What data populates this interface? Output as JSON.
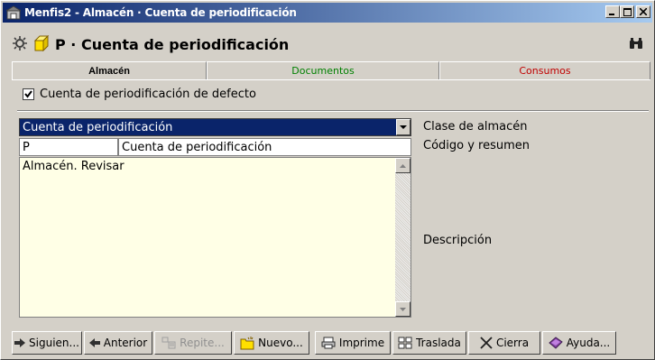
{
  "window": {
    "title": "Menfis2 - Almacén · Cuenta de periodificación"
  },
  "header": {
    "title": "P · Cuenta de periodificación"
  },
  "tabs": [
    {
      "label": "Almacén",
      "active": true,
      "color": "#000000"
    },
    {
      "label": "Documentos",
      "active": false,
      "color": "#008000"
    },
    {
      "label": "Consumos",
      "active": false,
      "color": "#c00000"
    }
  ],
  "form": {
    "default_checkbox_label": "Cuenta de periodificación de defecto",
    "default_checked": true,
    "clase_value": "Cuenta de periodificación",
    "codigo_value": "P",
    "resumen_value": "Cuenta de periodificación",
    "descripcion_value": "Almacén. Revisar",
    "labels": {
      "clase": "Clase de almacén",
      "codigo": "Código y resumen",
      "descripcion": "Descripción"
    }
  },
  "toolbar": {
    "buttons": [
      {
        "label": "Siguien...",
        "icon": "arrow-right-icon",
        "enabled": true
      },
      {
        "label": "Anterior",
        "icon": "arrow-left-icon",
        "enabled": true
      },
      {
        "label": "Repite...",
        "icon": "repeat-icon",
        "enabled": false
      },
      {
        "label": "Nuevo...",
        "icon": "new-folder-icon",
        "enabled": true
      },
      {
        "label": "Imprime",
        "icon": "printer-icon",
        "enabled": true
      },
      {
        "label": "Traslada",
        "icon": "transfer-icon",
        "enabled": true
      },
      {
        "label": "Cierra",
        "icon": "close-x-icon",
        "enabled": true
      },
      {
        "label": "Ayuda...",
        "icon": "help-book-icon",
        "enabled": true
      }
    ]
  },
  "colors": {
    "titlebar_start": "#0a246a",
    "titlebar_end": "#a6caf0",
    "memo_background": "#ffffe6",
    "face": "#d4d0c8"
  }
}
